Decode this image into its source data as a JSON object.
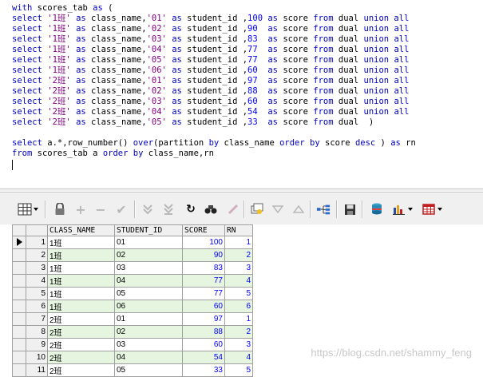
{
  "editor": {
    "lines": [
      [
        {
          "t": "with",
          "c": "kw"
        },
        {
          "t": " scores_tab "
        },
        {
          "t": "as",
          "c": "kw"
        },
        {
          "t": " ("
        }
      ],
      [
        {
          "t": "select",
          "c": "kw"
        },
        {
          "t": " "
        },
        {
          "t": "'1班'",
          "c": "str"
        },
        {
          "t": " "
        },
        {
          "t": "as",
          "c": "kw"
        },
        {
          "t": " class_name,"
        },
        {
          "t": "'01'",
          "c": "str"
        },
        {
          "t": " "
        },
        {
          "t": "as",
          "c": "kw"
        },
        {
          "t": " student_id ,"
        },
        {
          "t": "100",
          "c": "num"
        },
        {
          "t": " "
        },
        {
          "t": "as",
          "c": "kw"
        },
        {
          "t": " score "
        },
        {
          "t": "from",
          "c": "kw"
        },
        {
          "t": " dual "
        },
        {
          "t": "union all",
          "c": "kw"
        }
      ],
      [
        {
          "t": "select",
          "c": "kw"
        },
        {
          "t": " "
        },
        {
          "t": "'1班'",
          "c": "str"
        },
        {
          "t": " "
        },
        {
          "t": "as",
          "c": "kw"
        },
        {
          "t": " class_name,"
        },
        {
          "t": "'02'",
          "c": "str"
        },
        {
          "t": " "
        },
        {
          "t": "as",
          "c": "kw"
        },
        {
          "t": " student_id ,"
        },
        {
          "t": "90",
          "c": "num"
        },
        {
          "t": "  "
        },
        {
          "t": "as",
          "c": "kw"
        },
        {
          "t": " score "
        },
        {
          "t": "from",
          "c": "kw"
        },
        {
          "t": " dual "
        },
        {
          "t": "union all",
          "c": "kw"
        }
      ],
      [
        {
          "t": "select",
          "c": "kw"
        },
        {
          "t": " "
        },
        {
          "t": "'1班'",
          "c": "str"
        },
        {
          "t": " "
        },
        {
          "t": "as",
          "c": "kw"
        },
        {
          "t": " class_name,"
        },
        {
          "t": "'03'",
          "c": "str"
        },
        {
          "t": " "
        },
        {
          "t": "as",
          "c": "kw"
        },
        {
          "t": " student_id ,"
        },
        {
          "t": "83",
          "c": "num"
        },
        {
          "t": "  "
        },
        {
          "t": "as",
          "c": "kw"
        },
        {
          "t": " score "
        },
        {
          "t": "from",
          "c": "kw"
        },
        {
          "t": " dual "
        },
        {
          "t": "union all",
          "c": "kw"
        }
      ],
      [
        {
          "t": "select",
          "c": "kw"
        },
        {
          "t": " "
        },
        {
          "t": "'1班'",
          "c": "str"
        },
        {
          "t": " "
        },
        {
          "t": "as",
          "c": "kw"
        },
        {
          "t": " class_name,"
        },
        {
          "t": "'04'",
          "c": "str"
        },
        {
          "t": " "
        },
        {
          "t": "as",
          "c": "kw"
        },
        {
          "t": " student_id ,"
        },
        {
          "t": "77",
          "c": "num"
        },
        {
          "t": "  "
        },
        {
          "t": "as",
          "c": "kw"
        },
        {
          "t": " score "
        },
        {
          "t": "from",
          "c": "kw"
        },
        {
          "t": " dual "
        },
        {
          "t": "union all",
          "c": "kw"
        }
      ],
      [
        {
          "t": "select",
          "c": "kw"
        },
        {
          "t": " "
        },
        {
          "t": "'1班'",
          "c": "str"
        },
        {
          "t": " "
        },
        {
          "t": "as",
          "c": "kw"
        },
        {
          "t": " class_name,"
        },
        {
          "t": "'05'",
          "c": "str"
        },
        {
          "t": " "
        },
        {
          "t": "as",
          "c": "kw"
        },
        {
          "t": " student_id ,"
        },
        {
          "t": "77",
          "c": "num"
        },
        {
          "t": "  "
        },
        {
          "t": "as",
          "c": "kw"
        },
        {
          "t": " score "
        },
        {
          "t": "from",
          "c": "kw"
        },
        {
          "t": " dual "
        },
        {
          "t": "union all",
          "c": "kw"
        }
      ],
      [
        {
          "t": "select",
          "c": "kw"
        },
        {
          "t": " "
        },
        {
          "t": "'1班'",
          "c": "str"
        },
        {
          "t": " "
        },
        {
          "t": "as",
          "c": "kw"
        },
        {
          "t": " class_name,"
        },
        {
          "t": "'06'",
          "c": "str"
        },
        {
          "t": " "
        },
        {
          "t": "as",
          "c": "kw"
        },
        {
          "t": " student_id ,"
        },
        {
          "t": "60",
          "c": "num"
        },
        {
          "t": "  "
        },
        {
          "t": "as",
          "c": "kw"
        },
        {
          "t": " score "
        },
        {
          "t": "from",
          "c": "kw"
        },
        {
          "t": " dual "
        },
        {
          "t": "union all",
          "c": "kw"
        }
      ],
      [
        {
          "t": "select",
          "c": "kw"
        },
        {
          "t": " "
        },
        {
          "t": "'2班'",
          "c": "str"
        },
        {
          "t": " "
        },
        {
          "t": "as",
          "c": "kw"
        },
        {
          "t": " class_name,"
        },
        {
          "t": "'01'",
          "c": "str"
        },
        {
          "t": " "
        },
        {
          "t": "as",
          "c": "kw"
        },
        {
          "t": " student_id ,"
        },
        {
          "t": "97",
          "c": "num"
        },
        {
          "t": "  "
        },
        {
          "t": "as",
          "c": "kw"
        },
        {
          "t": " score "
        },
        {
          "t": "from",
          "c": "kw"
        },
        {
          "t": " dual "
        },
        {
          "t": "union all",
          "c": "kw"
        }
      ],
      [
        {
          "t": "select",
          "c": "kw"
        },
        {
          "t": " "
        },
        {
          "t": "'2班'",
          "c": "str"
        },
        {
          "t": " "
        },
        {
          "t": "as",
          "c": "kw"
        },
        {
          "t": " class_name,"
        },
        {
          "t": "'02'",
          "c": "str"
        },
        {
          "t": " "
        },
        {
          "t": "as",
          "c": "kw"
        },
        {
          "t": " student_id ,"
        },
        {
          "t": "88",
          "c": "num"
        },
        {
          "t": "  "
        },
        {
          "t": "as",
          "c": "kw"
        },
        {
          "t": " score "
        },
        {
          "t": "from",
          "c": "kw"
        },
        {
          "t": " dual "
        },
        {
          "t": "union all",
          "c": "kw"
        }
      ],
      [
        {
          "t": "select",
          "c": "kw"
        },
        {
          "t": " "
        },
        {
          "t": "'2班'",
          "c": "str"
        },
        {
          "t": " "
        },
        {
          "t": "as",
          "c": "kw"
        },
        {
          "t": " class_name,"
        },
        {
          "t": "'03'",
          "c": "str"
        },
        {
          "t": " "
        },
        {
          "t": "as",
          "c": "kw"
        },
        {
          "t": " student_id ,"
        },
        {
          "t": "60",
          "c": "num"
        },
        {
          "t": "  "
        },
        {
          "t": "as",
          "c": "kw"
        },
        {
          "t": " score "
        },
        {
          "t": "from",
          "c": "kw"
        },
        {
          "t": " dual "
        },
        {
          "t": "union all",
          "c": "kw"
        }
      ],
      [
        {
          "t": "select",
          "c": "kw"
        },
        {
          "t": " "
        },
        {
          "t": "'2班'",
          "c": "str"
        },
        {
          "t": " "
        },
        {
          "t": "as",
          "c": "kw"
        },
        {
          "t": " class_name,"
        },
        {
          "t": "'04'",
          "c": "str"
        },
        {
          "t": " "
        },
        {
          "t": "as",
          "c": "kw"
        },
        {
          "t": " student_id ,"
        },
        {
          "t": "54",
          "c": "num"
        },
        {
          "t": "  "
        },
        {
          "t": "as",
          "c": "kw"
        },
        {
          "t": " score "
        },
        {
          "t": "from",
          "c": "kw"
        },
        {
          "t": " dual "
        },
        {
          "t": "union all",
          "c": "kw"
        }
      ],
      [
        {
          "t": "select",
          "c": "kw"
        },
        {
          "t": " "
        },
        {
          "t": "'2班'",
          "c": "str"
        },
        {
          "t": " "
        },
        {
          "t": "as",
          "c": "kw"
        },
        {
          "t": " class_name,"
        },
        {
          "t": "'05'",
          "c": "str"
        },
        {
          "t": " "
        },
        {
          "t": "as",
          "c": "kw"
        },
        {
          "t": " student_id ,"
        },
        {
          "t": "33",
          "c": "num"
        },
        {
          "t": "  "
        },
        {
          "t": "as",
          "c": "kw"
        },
        {
          "t": " score "
        },
        {
          "t": "from",
          "c": "kw"
        },
        {
          "t": " dual  )"
        }
      ],
      [
        {
          "t": ""
        }
      ],
      [
        {
          "t": "select",
          "c": "kw"
        },
        {
          "t": " a.*,row_number() "
        },
        {
          "t": "over",
          "c": "kw"
        },
        {
          "t": "(partition "
        },
        {
          "t": "by",
          "c": "kw"
        },
        {
          "t": " class_name "
        },
        {
          "t": "order by",
          "c": "kw"
        },
        {
          "t": " score "
        },
        {
          "t": "desc",
          "c": "kw"
        },
        {
          "t": " ) "
        },
        {
          "t": "as",
          "c": "kw"
        },
        {
          "t": " rn"
        }
      ],
      [
        {
          "t": "from",
          "c": "kw"
        },
        {
          "t": " scores_tab a "
        },
        {
          "t": "order by",
          "c": "kw"
        },
        {
          "t": " class_name,rn"
        }
      ]
    ]
  },
  "toolbar": {
    "icons": [
      "grid-view-icon",
      "lock-icon",
      "add-record-icon",
      "delete-record-icon",
      "post-changes-icon",
      "next-record-icon",
      "last-record-icon",
      "refresh-icon",
      "find-icon",
      "clear-icon",
      "export-icon",
      "filter-down-icon",
      "filter-up-icon",
      "tree-icon",
      "save-icon",
      "database-icon",
      "chart-icon",
      "table-icon"
    ]
  },
  "grid": {
    "columns": [
      "CLASS_NAME",
      "STUDENT_ID",
      "SCORE",
      "RN"
    ],
    "rows": [
      {
        "n": "1",
        "cls": "1班",
        "sid": "01",
        "score": "100",
        "rn": "1"
      },
      {
        "n": "2",
        "cls": "1班",
        "sid": "02",
        "score": "90",
        "rn": "2"
      },
      {
        "n": "3",
        "cls": "1班",
        "sid": "03",
        "score": "83",
        "rn": "3"
      },
      {
        "n": "4",
        "cls": "1班",
        "sid": "04",
        "score": "77",
        "rn": "4"
      },
      {
        "n": "5",
        "cls": "1班",
        "sid": "05",
        "score": "77",
        "rn": "5"
      },
      {
        "n": "6",
        "cls": "1班",
        "sid": "06",
        "score": "60",
        "rn": "6"
      },
      {
        "n": "7",
        "cls": "2班",
        "sid": "01",
        "score": "97",
        "rn": "1"
      },
      {
        "n": "8",
        "cls": "2班",
        "sid": "02",
        "score": "88",
        "rn": "2"
      },
      {
        "n": "9",
        "cls": "2班",
        "sid": "03",
        "score": "60",
        "rn": "3"
      },
      {
        "n": "10",
        "cls": "2班",
        "sid": "04",
        "score": "54",
        "rn": "4"
      },
      {
        "n": "11",
        "cls": "2班",
        "sid": "05",
        "score": "33",
        "rn": "5"
      }
    ]
  },
  "watermark": "https://blog.csdn.net/shammy_feng"
}
